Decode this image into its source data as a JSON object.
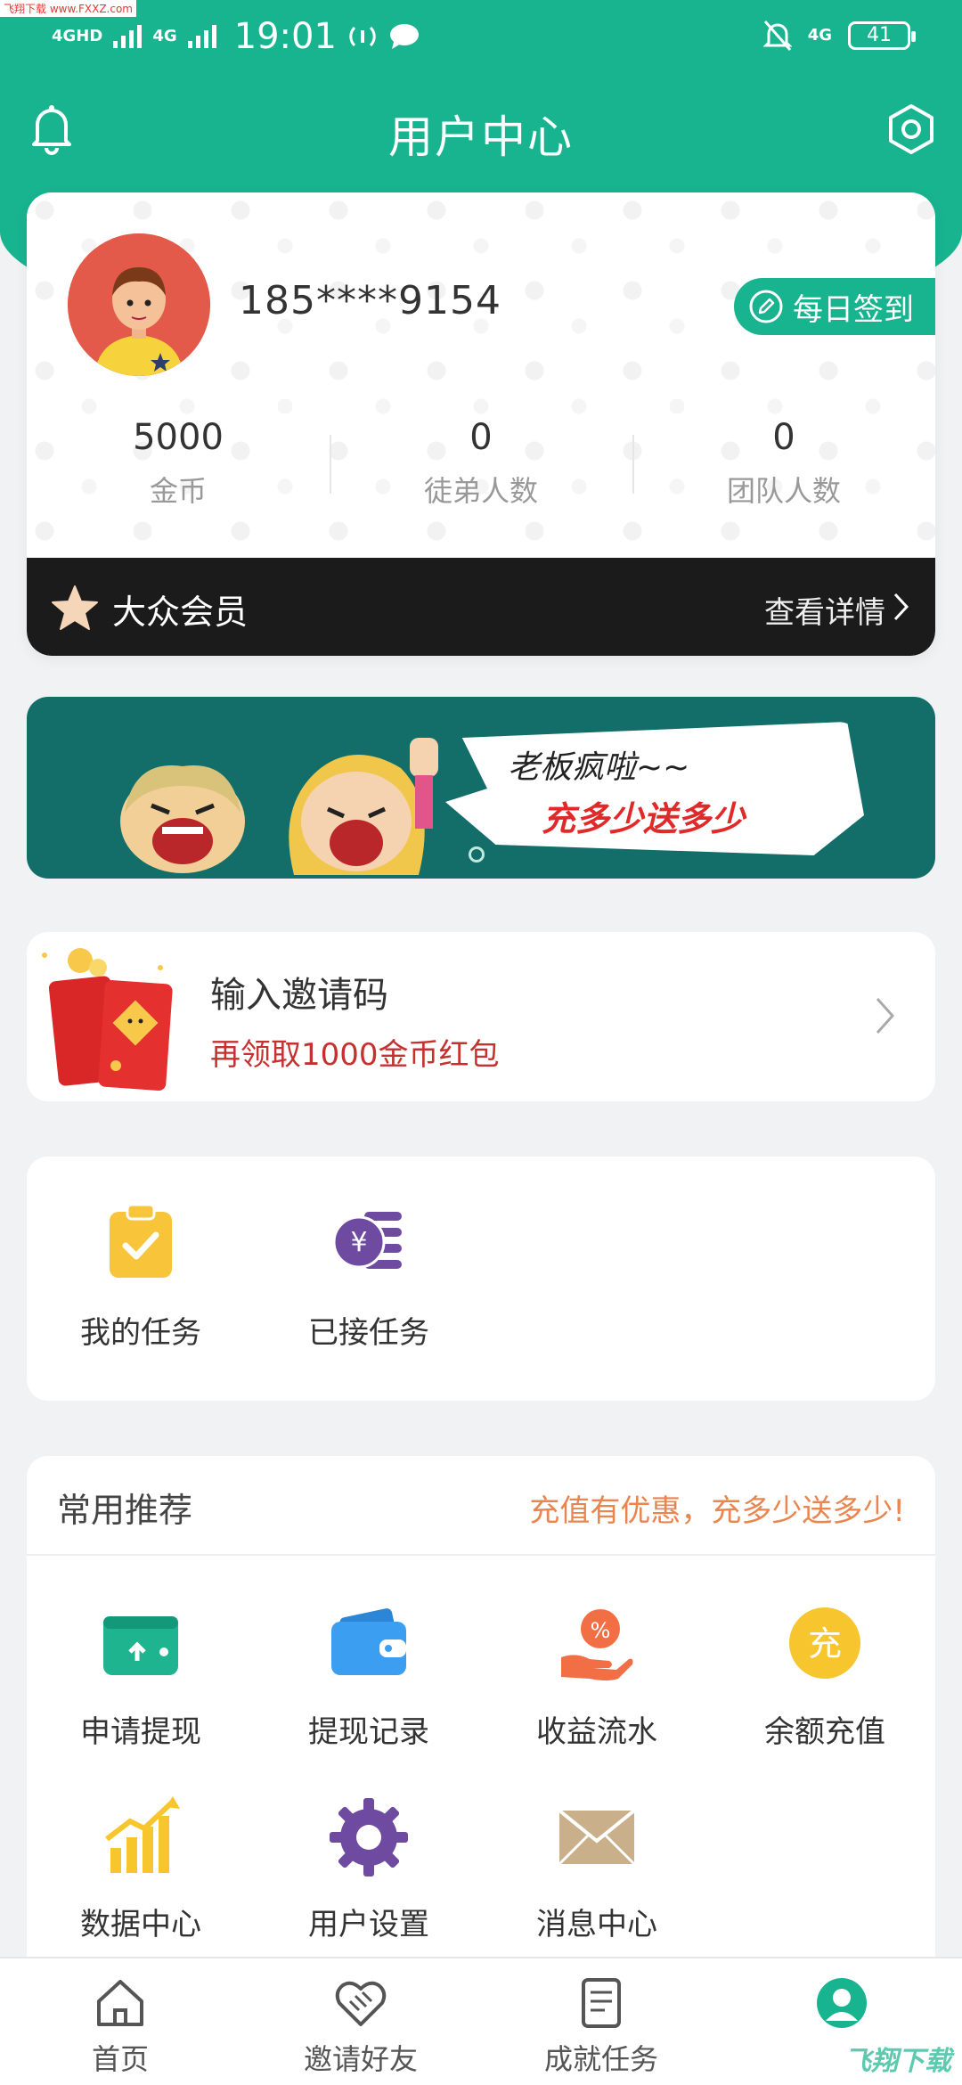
{
  "status_bar": {
    "network1": "4GHD",
    "network2": "4G",
    "time": "19:01",
    "network3": "4G",
    "battery": "41",
    "watermark": "飞翔下载 www.FXXZ.com"
  },
  "header": {
    "title": "用户中心"
  },
  "profile": {
    "phone": "185****9154",
    "signin_label": "每日签到",
    "stats": [
      {
        "value": "5000",
        "label": "金币"
      },
      {
        "value": "0",
        "label": "徒弟人数"
      },
      {
        "value": "0",
        "label": "团队人数"
      }
    ],
    "member_level": "大众会员",
    "member_detail": "查看详情"
  },
  "banner": {
    "line1": "老板疯啦~~",
    "line2": "充多少送多少"
  },
  "invite": {
    "title": "输入邀请码",
    "subtitle": "再领取1000金币红包"
  },
  "tasks": [
    {
      "label": "我的任务",
      "icon": "clipboard-check-icon"
    },
    {
      "label": "已接任务",
      "icon": "coin-stack-icon"
    }
  ],
  "recommend": {
    "title": "常用推荐",
    "promo": "充值有优惠，充多少送多少!",
    "items": [
      {
        "label": "申请提现",
        "icon": "wallet-icon"
      },
      {
        "label": "提现记录",
        "icon": "wallet-record-icon"
      },
      {
        "label": "收益流水",
        "icon": "income-hand-icon"
      },
      {
        "label": "余额充值",
        "icon": "recharge-icon",
        "glyph": "充"
      },
      {
        "label": "数据中心",
        "icon": "chart-icon"
      },
      {
        "label": "用户设置",
        "icon": "settings-gear-icon"
      },
      {
        "label": "消息中心",
        "icon": "envelope-icon"
      }
    ]
  },
  "bottom_nav": [
    {
      "label": "首页",
      "icon": "home-icon"
    },
    {
      "label": "邀请好友",
      "icon": "handshake-icon"
    },
    {
      "label": "成就任务",
      "icon": "document-icon"
    },
    {
      "label": "",
      "icon": "user-icon",
      "active": true
    }
  ],
  "watermark_bottom": "飞翔下载",
  "colors": {
    "brand": "#18b48f",
    "member_bar": "#1b1b1b",
    "promo": "#e9854f",
    "invite_sub": "#c5312e"
  }
}
